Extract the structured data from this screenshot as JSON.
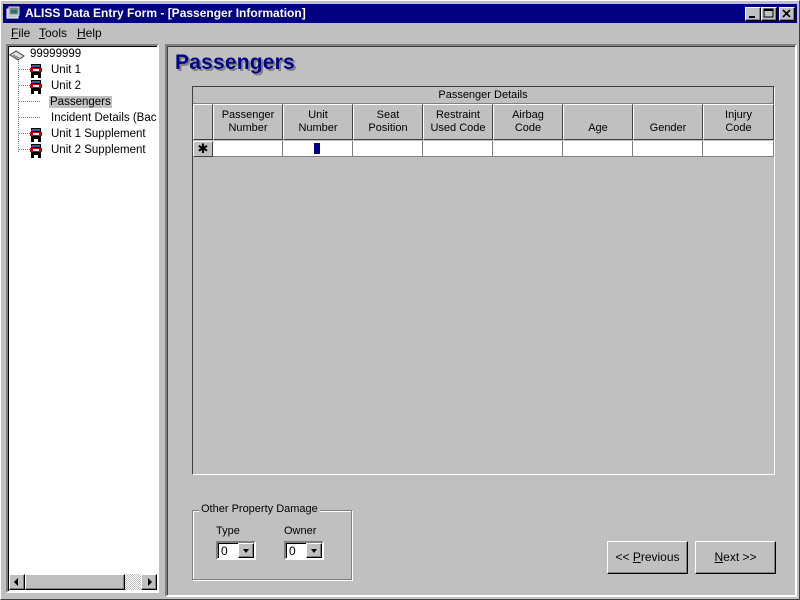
{
  "window": {
    "title": "ALISS Data Entry Form - [Passenger Information]",
    "controls": [
      "minimize",
      "maximize",
      "close"
    ]
  },
  "menu": {
    "items": [
      {
        "label": "File",
        "mnemonic": "F"
      },
      {
        "label": "Tools",
        "mnemonic": "T"
      },
      {
        "label": "Help",
        "mnemonic": "H"
      }
    ]
  },
  "tree": {
    "root": {
      "label": "99999999",
      "icon": "case-file-icon"
    },
    "items": [
      {
        "label": "Unit 1",
        "icon": "vehicle-icon",
        "selected": false
      },
      {
        "label": "Unit 2",
        "icon": "vehicle-icon",
        "selected": false
      },
      {
        "label": "Passengers",
        "icon": "",
        "selected": true
      },
      {
        "label": "Incident Details (BackF",
        "icon": "",
        "selected": false
      },
      {
        "label": "Unit 1 Supplement",
        "icon": "vehicle-icon",
        "selected": false
      },
      {
        "label": "Unit 2 Supplement",
        "icon": "vehicle-icon",
        "selected": false
      }
    ]
  },
  "main": {
    "heading": "Passengers",
    "grid": {
      "caption": "Passenger Details",
      "columns": [
        "Passenger\nNumber",
        "Unit\nNumber",
        "Seat\nPosition",
        "Restraint\nUsed Code",
        "Airbag\nCode",
        "Age",
        "Gender",
        "Injury\nCode"
      ],
      "new_row_marker": "✱",
      "rows": [
        [
          "",
          "",
          "",
          "",
          "",
          "",
          "",
          ""
        ]
      ]
    },
    "property_damage": {
      "title": "Other Property Damage",
      "type": {
        "label": "Type",
        "value": "0"
      },
      "owner": {
        "label": "Owner",
        "value": "0"
      }
    },
    "buttons": {
      "previous": {
        "prefix": "<< ",
        "mnemonic": "P",
        "rest": "revious"
      },
      "next": {
        "prefix": "",
        "mnemonic": "N",
        "rest": "ext >>"
      }
    }
  }
}
